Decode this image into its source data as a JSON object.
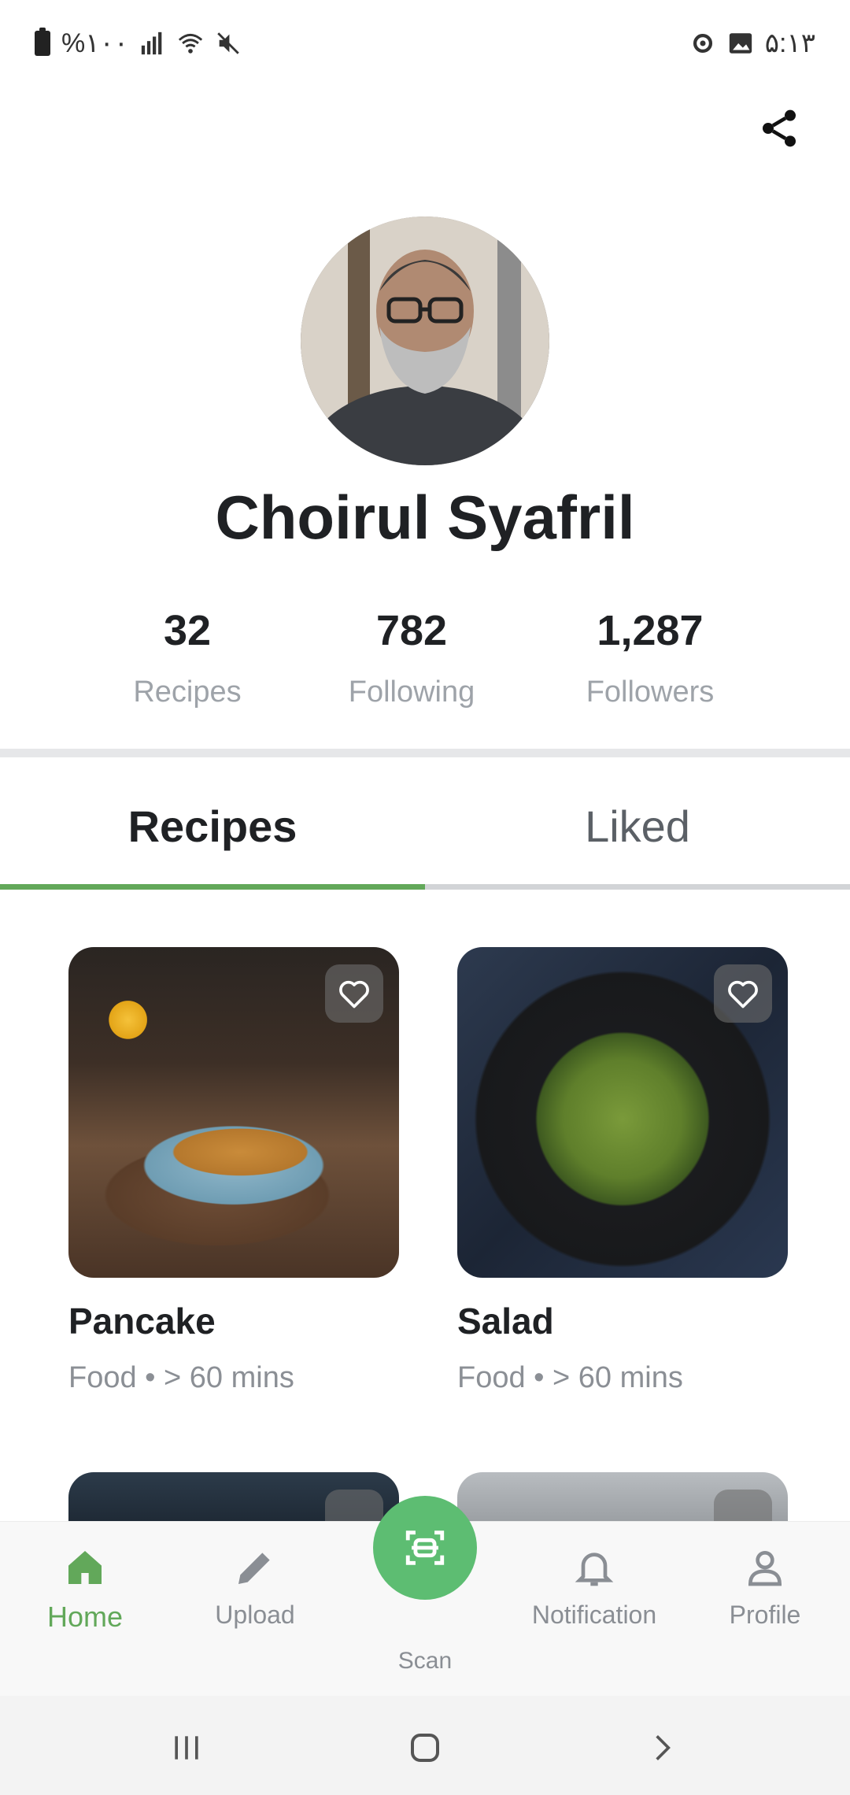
{
  "status_bar": {
    "battery_text": "%۱۰۰",
    "time": "۵:۱۳"
  },
  "profile": {
    "name": "Choirul Syafril",
    "stats": [
      {
        "value": "32",
        "label": "Recipes"
      },
      {
        "value": "782",
        "label": "Following"
      },
      {
        "value": "1,287",
        "label": "Followers"
      }
    ]
  },
  "tabs": [
    {
      "label": "Recipes",
      "active": true
    },
    {
      "label": "Liked",
      "active": false
    }
  ],
  "recipes": [
    {
      "title": "Pancake",
      "meta": "Food • > 60 mins"
    },
    {
      "title": "Salad",
      "meta": "Food • > 60 mins"
    }
  ],
  "bottom_nav": {
    "home": "Home",
    "upload": "Upload",
    "scan": "Scan",
    "notification": "Notification",
    "profile": "Profile"
  },
  "colors": {
    "accent": "#62a85a",
    "fab": "#5dbd72"
  }
}
